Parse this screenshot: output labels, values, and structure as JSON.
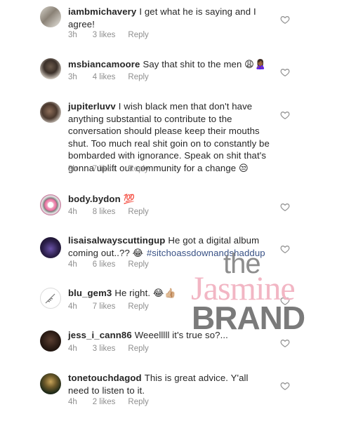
{
  "comments": [
    {
      "username": "iambmichavery",
      "text": "I get what he is saying and I agree!",
      "time": "3h",
      "likes": "3 likes",
      "reply": "Reply",
      "avatar": "avatar-photo"
    },
    {
      "username": "msbiancamoore",
      "text": "Say that shit to the men",
      "emoji": "😩🙎🏾‍♀️",
      "time": "3h",
      "likes": "4 likes",
      "reply": "Reply",
      "avatar": "avatar-photo"
    },
    {
      "username": "jupiterluvv",
      "text": "I wish black men that don't have anything substantial to contribute to the conversation should please keep their mouths shut. Too much real shit goin on to constantly be bombarded with ignorance. Speak on shit that's gonna uplift our community for a change",
      "emoji": "😒",
      "time": "3h",
      "likes": "7 likes",
      "reply": "Reply",
      "avatar": "avatar-photo"
    },
    {
      "username": "body.bydon",
      "text": "",
      "emoji": "💯",
      "time": "4h",
      "likes": "8 likes",
      "reply": "Reply",
      "avatar": "avatar-pattern"
    },
    {
      "username": "lisaisalwayscuttingup",
      "text": "He got a digital album coming out..??",
      "emoji": "😂",
      "hashtag": "#sitchoassdownandshaddup",
      "time": "4h",
      "likes": "6 likes",
      "reply": "Reply",
      "avatar": "avatar-photo"
    },
    {
      "username": "blu_gem3",
      "text": "He right.",
      "emoji": "😂👍🏼",
      "time": "4h",
      "likes": "7 likes",
      "reply": "Reply",
      "avatar": "avatar-drawing"
    },
    {
      "username": "jess_i_cann86",
      "text": "Weeelllll it's true so?...",
      "time": "4h",
      "likes": "3 likes",
      "reply": "Reply",
      "avatar": "avatar-photo"
    },
    {
      "username": "tonetouchdagod",
      "text": "This is great advice. Y'all need to listen to it.",
      "time": "4h",
      "likes": "2 likes",
      "reply": "Reply",
      "avatar": "avatar-photo"
    }
  ],
  "watermark": {
    "line1": "the",
    "line2": "Jasmine",
    "line3": "BRAND"
  },
  "colors": {
    "username": "#262626",
    "meta": "#8e8e8e",
    "hashtag": "#385185",
    "heart": "#8e8e8e"
  }
}
